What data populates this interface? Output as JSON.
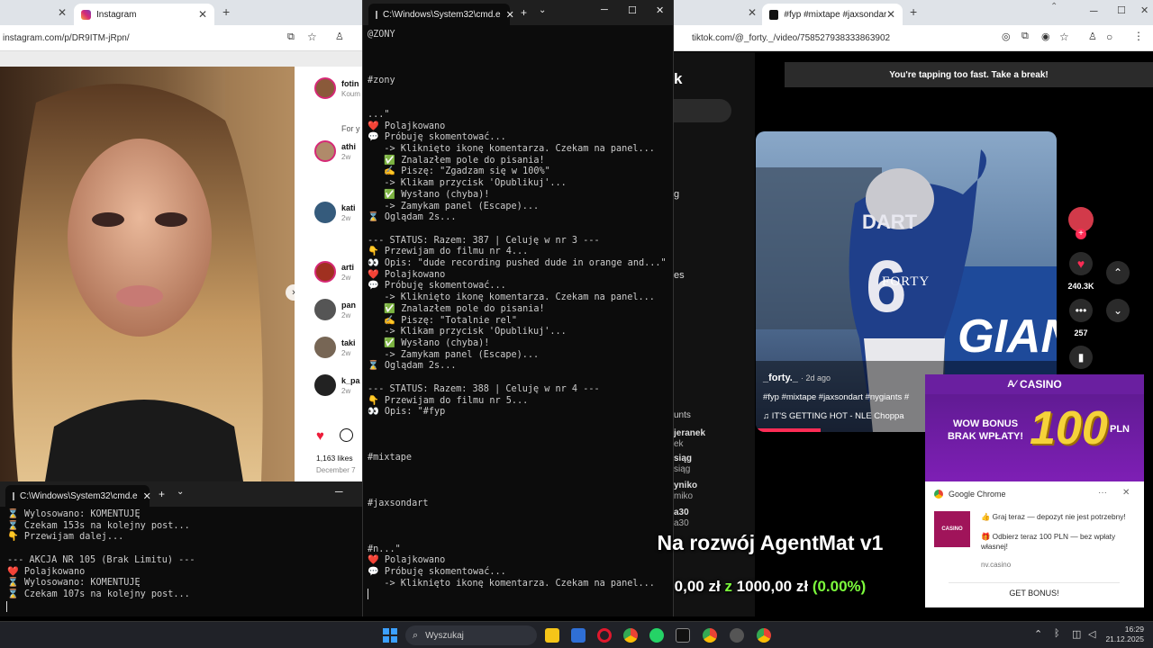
{
  "left_window": {
    "tab_title": "Instagram",
    "url": "instagram.com/p/DR9ITM-jRpn/",
    "sidebar_items": [
      {
        "name": "fotin",
        "sub": "Koum",
        "color": "#8a5a3a"
      },
      {
        "name": "For y",
        "sub": "",
        "color": "#ffffff"
      },
      {
        "name": "athi",
        "sub": "2w",
        "color": "#b08a6a"
      },
      {
        "name": "kati",
        "sub": "2w",
        "color": "#355b7c"
      },
      {
        "name": "arti",
        "sub": "2w",
        "color": "#a03020"
      },
      {
        "name": "pan",
        "sub": "2w",
        "color": "#555"
      },
      {
        "name": "taki",
        "sub": "2w",
        "color": "#776655"
      },
      {
        "name": "k_pa",
        "sub": "2w",
        "color": "#222"
      }
    ],
    "likes": "1,163 likes",
    "date": "December 7"
  },
  "bottom_cmd": {
    "title": "C:\\Windows\\System32\\cmd.e",
    "lines": [
      "⌛ Wylosowano: KOMENTUJĘ",
      "⌛ Czekam 153s na kolejny post...",
      "👇 Przewijam dalej...",
      "",
      "--- AKCJA NR 105 (Brak Limitu) ---",
      "❤️ Polajkowano",
      "⌛ Wylosowano: KOMENTUJĘ",
      "⌛ Czekam 107s na kolejny post..."
    ]
  },
  "mid_cmd": {
    "title": "C:\\Windows\\System32\\cmd.e",
    "lines": [
      "@ZONY",
      "",
      "",
      "",
      "#zony",
      "",
      "",
      "...\"",
      "❤️ Polajkowano",
      "💬 Próbuję skomentować...",
      "   -> Kliknięto ikonę komentarza. Czekam na panel...",
      "   ✅ Znalazłem pole do pisania!",
      "   ✍️ Piszę: \"Zgadzam się w 100%\"",
      "   -> Klikam przycisk 'Opublikuj'...",
      "   ✅ Wysłano (chyba)!",
      "   -> Zamykam panel (Escape)...",
      "⌛ Oglądam 2s...",
      "",
      "--- STATUS: Razem: 387 | Celuję w nr 3 ---",
      "👇 Przewijam do filmu nr 4...",
      "👀 Opis: \"dude recording pushed dude in orange and...\"",
      "❤️ Polajkowano",
      "💬 Próbuję skomentować...",
      "   -> Kliknięto ikonę komentarza. Czekam na panel...",
      "   ✅ Znalazłem pole do pisania!",
      "   ✍️ Piszę: \"Totalnie rel\"",
      "   -> Klikam przycisk 'Opublikuj'...",
      "   ✅ Wysłano (chyba)!",
      "   -> Zamykam panel (Escape)...",
      "⌛ Oglądam 2s...",
      "",
      "--- STATUS: Razem: 388 | Celuję w nr 4 ---",
      "👇 Przewijam do filmu nr 5...",
      "👀 Opis: \"#fyp",
      "",
      "",
      "",
      "#mixtape",
      "",
      "",
      "",
      "#jaxsondart",
      "",
      "",
      "",
      "#n...\"",
      "❤️ Polajkowano",
      "💬 Próbuję skomentować...",
      "   -> Kliknięto ikonę komentarza. Czekam na panel...",
      ""
    ]
  },
  "right_window": {
    "tab_title": "#fyp #mixtape #jaxsondart",
    "url": "tiktok.com/@_forty._/video/758527938333863902",
    "toast": "You're tapping too fast. Take a break!",
    "jersey_name": "DART",
    "jersey_number": "6",
    "watermark": "FORTY",
    "wall_text": "GIANTS",
    "author": "_forty._",
    "posted": "· 2d ago",
    "hashtags": "#fyp #mixtape #jaxsondart #nygiants #",
    "music": "♫  IT'S GETTING HOT - NLE Choppa",
    "like_count": "240.3K",
    "comment_count": "257",
    "side_fragments": [
      "k",
      "g",
      "es",
      "unts",
      "jeranek",
      "ek",
      "siąg",
      "siąg",
      "yniko",
      "miko",
      "a30",
      "a30"
    ]
  },
  "casino_ad": {
    "brand": "CASINO",
    "headline": "WOW BONUS\nBRAK WPŁATY!",
    "amount": "100",
    "currency": "PLN"
  },
  "notification": {
    "app": "Google Chrome",
    "logo_text": "CASINO",
    "line1": "👍 Graj teraz — depozyt nie jest potrzebny!",
    "line2": "🎁 Odbierz teraz 100 PLN — bez wpłaty własnej!",
    "domain": "nv.casino",
    "button": "GET BONUS!"
  },
  "overlay": {
    "title": "Na rozwój AgentMat v1",
    "current": "0,00 zł",
    "sep": "z",
    "goal": "1000,00 zł",
    "percent": "(0.00%)",
    "percent_color": "#7cfc3c"
  },
  "taskbar": {
    "search_placeholder": "Wyszukaj",
    "time": "16:29",
    "date": "21.12.2025"
  }
}
